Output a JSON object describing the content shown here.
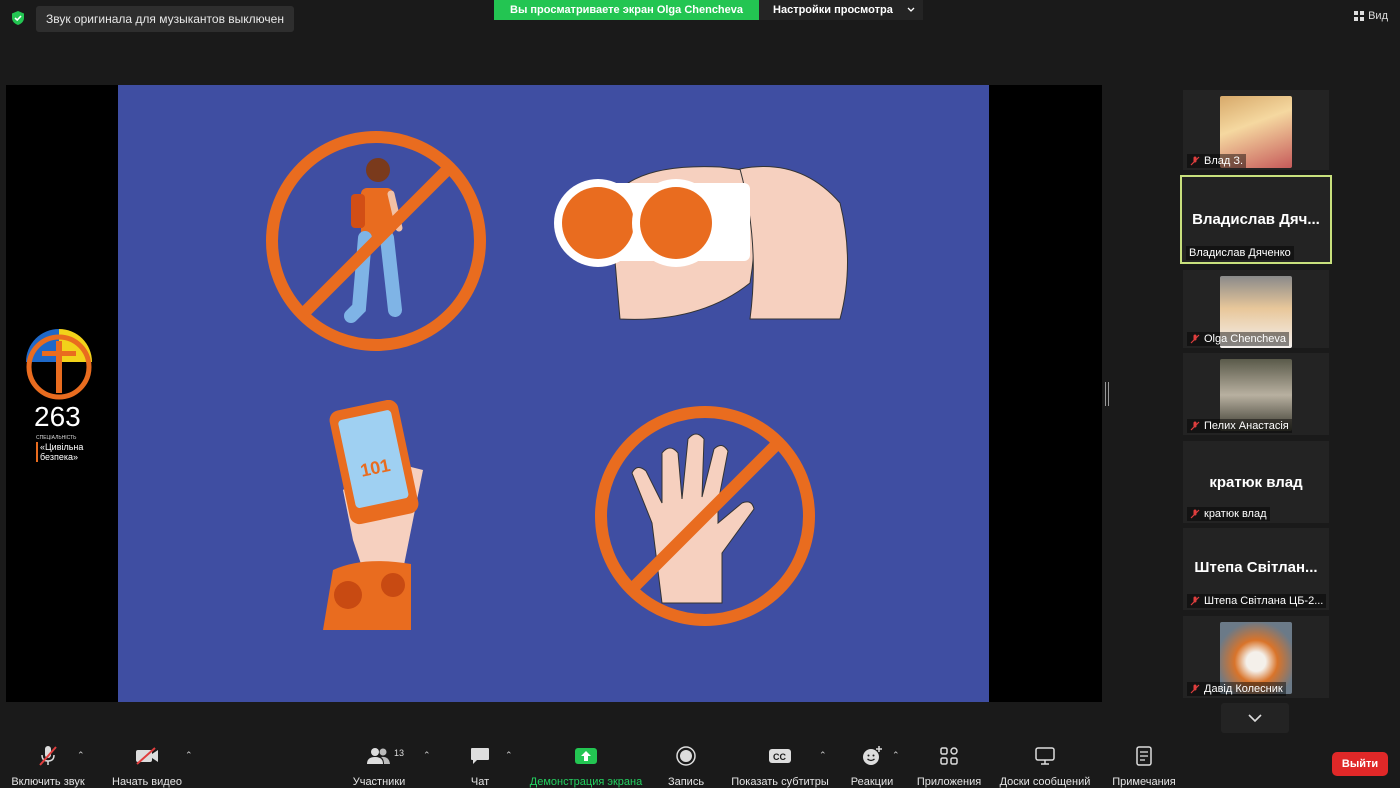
{
  "top": {
    "notice": "Звук оригинала для музыкантов выключен",
    "sharing_label": "Вы просматриваете экран Olga Chencheva",
    "view_options": "Настройки просмотра",
    "view_button": "Вид"
  },
  "slide": {
    "logo_number": "263",
    "logo_sub": "спеціальність",
    "logo_name_1": "«Цивільна",
    "logo_name_2": "безпека»",
    "phone_text": "101"
  },
  "participants": [
    {
      "name": "Влад З.",
      "muted": true,
      "type": "avatar"
    },
    {
      "name": "Владислав Дяченко",
      "display": "Владислав Дяч...",
      "muted": false,
      "type": "text",
      "active": true
    },
    {
      "name": "Olga Chencheva",
      "muted": true,
      "type": "avatar"
    },
    {
      "name": "Пелих Анастасія",
      "muted": true,
      "type": "avatar"
    },
    {
      "name": "кратюк влад",
      "display": "кратюк влад",
      "muted": true,
      "type": "text"
    },
    {
      "name": "Штепа Світлана ЦБ-2...",
      "display": "Штепа Світлан...",
      "muted": true,
      "type": "text"
    },
    {
      "name": "Давід Колесник",
      "muted": true,
      "type": "avatar"
    }
  ],
  "toolbar": {
    "unmute": "Включить звук",
    "start_video": "Начать видео",
    "participants": "Участники",
    "participants_count": "13",
    "chat": "Чат",
    "share": "Демонстрация экрана",
    "record": "Запись",
    "captions": "Показать субтитры",
    "captions_icon_text": "CC",
    "reactions": "Реакции",
    "apps": "Приложения",
    "whiteboards": "Доски сообщений",
    "notes": "Примечания",
    "leave": "Выйти"
  },
  "colors": {
    "accent_green": "#23c552",
    "leave_red": "#e02828",
    "slide_bg": "#3f4ea2",
    "slide_orange": "#e96c1f",
    "active_speaker_border": "#c8e07d"
  }
}
